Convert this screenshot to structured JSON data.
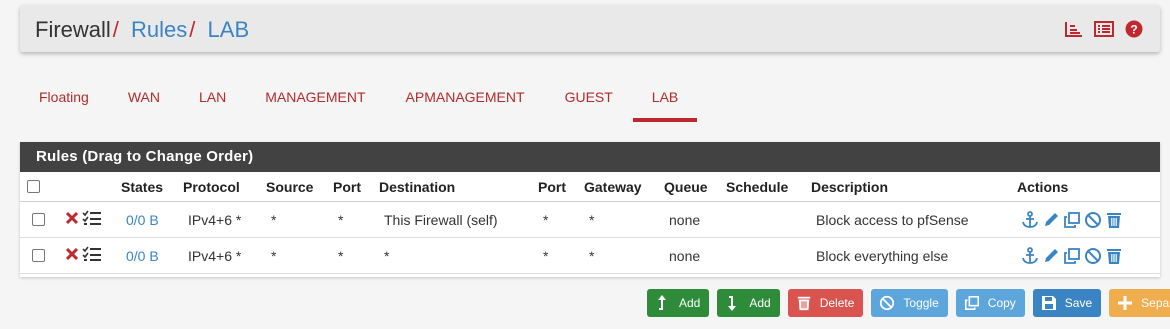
{
  "breadcrumb": {
    "firewall": "Firewall",
    "sep": "/",
    "rules": "Rules",
    "lab": "LAB"
  },
  "header_icons": [
    "chart-bars-icon",
    "list-alt-icon",
    "help-circle-icon"
  ],
  "tabs": [
    {
      "label": "Floating"
    },
    {
      "label": "WAN"
    },
    {
      "label": "LAN"
    },
    {
      "label": "MANAGEMENT"
    },
    {
      "label": "APMANAGEMENT"
    },
    {
      "label": "GUEST"
    },
    {
      "label": "LAB",
      "active": true
    }
  ],
  "panel": {
    "title": "Rules (Drag to Change Order)",
    "columns": {
      "states": "States",
      "protocol": "Protocol",
      "source": "Source",
      "port": "Port",
      "destination": "Destination",
      "dport": "Port",
      "gateway": "Gateway",
      "queue": "Queue",
      "schedule": "Schedule",
      "description": "Description",
      "actions": "Actions"
    },
    "rows": [
      {
        "states": "0/0 B",
        "protocol": "IPv4+6 *",
        "source": "*",
        "port": "*",
        "destination": "This Firewall (self)",
        "dport": "*",
        "gateway": "*",
        "queue": "none",
        "schedule": "",
        "description": "Block access to pfSense"
      },
      {
        "states": "0/0 B",
        "protocol": "IPv4+6 *",
        "source": "*",
        "port": "*",
        "destination": "*",
        "dport": "*",
        "gateway": "*",
        "queue": "none",
        "schedule": "",
        "description": "Block everything else"
      }
    ]
  },
  "buttons": {
    "add_top": "Add",
    "add_bottom": "Add",
    "delete": "Delete",
    "toggle": "Toggle",
    "copy": "Copy",
    "save": "Save",
    "separator": "Separator"
  },
  "colors": {
    "accent_red": "#c0282d",
    "link_blue": "#3b84c4",
    "panel_head": "#424242",
    "green": "#2e8b3a",
    "danger": "#d9534f",
    "info": "#5da6dc",
    "warning": "#f0ad4e"
  }
}
